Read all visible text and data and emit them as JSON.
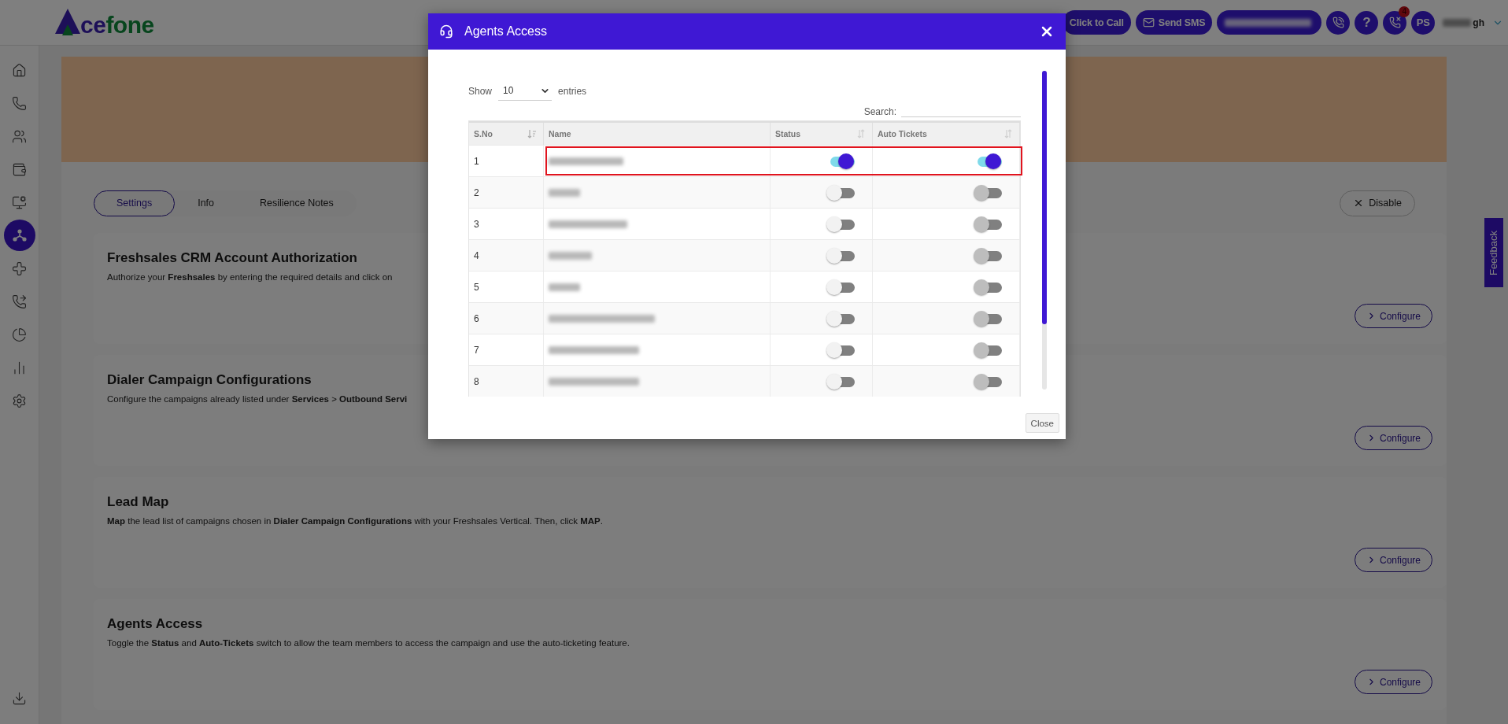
{
  "topbar": {
    "logo_parts": [
      "ce",
      "fone"
    ],
    "buttons": [
      {
        "label": "Click to Call"
      },
      {
        "label": "Send SMS"
      }
    ],
    "help": "?",
    "missed_badge": "4",
    "avatar": "PS",
    "user_name_tail": "gh"
  },
  "sidebar": {
    "items": [
      {
        "selected": false
      },
      {
        "selected": false
      },
      {
        "selected": false
      },
      {
        "selected": false
      },
      {
        "selected": false
      },
      {
        "selected": true
      },
      {
        "selected": false
      },
      {
        "selected": false
      },
      {
        "selected": false
      },
      {
        "selected": false
      },
      {
        "selected": false
      },
      {
        "selected": false
      }
    ]
  },
  "page": {
    "tabs": [
      {
        "label": "Settings",
        "selected": true
      },
      {
        "label": "Info",
        "selected": false
      },
      {
        "label": "Resilience Notes",
        "selected": false
      }
    ],
    "disable_button": "Disable",
    "cards": [
      {
        "title": "Freshsales CRM Account Authorization",
        "description": "Authorize your **Freshsales** by entering the required details and click on",
        "button": "Configure"
      },
      {
        "title": "Dialer Campaign Configurations",
        "description": "Configure the campaigns already listed under **Services** > **Outbound Servi**",
        "button": "Configure"
      },
      {
        "title": "Lead Map",
        "description": "**Map** the lead list of campaigns chosen in **Dialer Campaign Configurations** with your Freshsales Vertical. Then, click **MAP**.",
        "button": "Configure"
      },
      {
        "title": "Agents Access",
        "description": "Toggle the **Status** and **Auto-Tickets** switch to allow the team members to access the campaign and use the auto-ticketing feature.",
        "button": "Configure"
      }
    ]
  },
  "feedback": "Feedback",
  "modal": {
    "title": "Agents Access",
    "show_label": "Show",
    "page_size": "10",
    "entries_label": "entries",
    "search_label": "Search:",
    "columns": [
      {
        "label": "S.No",
        "sortable": true,
        "sorted": true
      },
      {
        "label": "Name",
        "sortable": false
      },
      {
        "label": "Status",
        "sortable": true,
        "sorted": false
      },
      {
        "label": "Auto Tickets",
        "sortable": true,
        "sorted": false
      }
    ],
    "rows": [
      {
        "sno": "1",
        "status": true,
        "auto_tickets": true,
        "highlighted": true
      },
      {
        "sno": "2",
        "status": false,
        "auto_tickets": false,
        "highlighted": false
      },
      {
        "sno": "3",
        "status": false,
        "auto_tickets": false,
        "highlighted": false
      },
      {
        "sno": "4",
        "status": false,
        "auto_tickets": false,
        "highlighted": false
      },
      {
        "sno": "5",
        "status": false,
        "auto_tickets": false,
        "highlighted": false
      },
      {
        "sno": "6",
        "status": false,
        "auto_tickets": false,
        "highlighted": false
      },
      {
        "sno": "7",
        "status": false,
        "auto_tickets": false,
        "highlighted": false
      },
      {
        "sno": "8",
        "status": false,
        "auto_tickets": false,
        "highlighted": false
      }
    ],
    "close_button": "Close"
  }
}
